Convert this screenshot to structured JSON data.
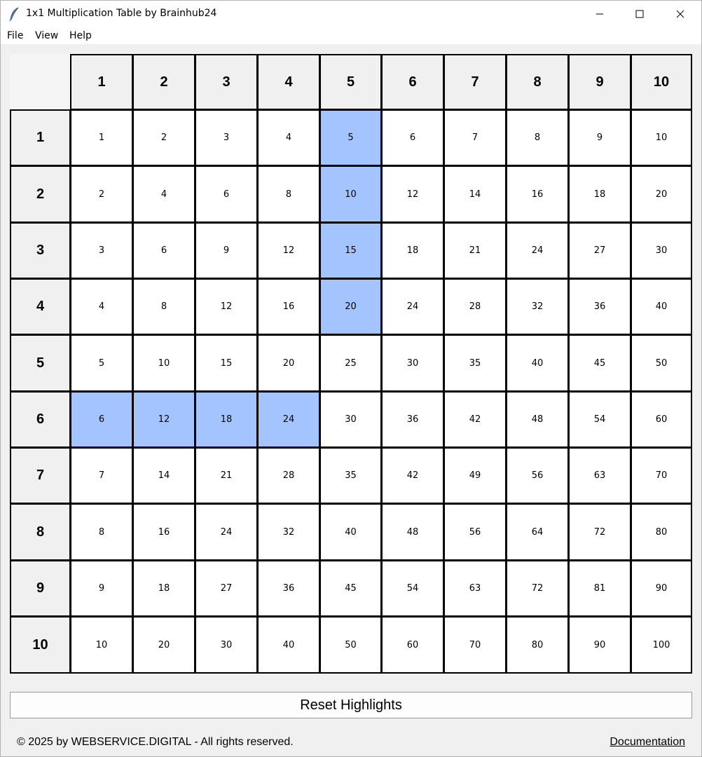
{
  "window": {
    "title": "1x1 Multiplication Table by Brainhub24",
    "icon": "feather-icon",
    "controls": [
      "minimize-icon",
      "maximize-icon",
      "close-icon"
    ]
  },
  "menu": [
    "File",
    "View",
    "Help"
  ],
  "table": {
    "column_headers": [
      "1",
      "2",
      "3",
      "4",
      "5",
      "6",
      "7",
      "8",
      "9",
      "10"
    ],
    "row_headers": [
      "1",
      "2",
      "3",
      "4",
      "5",
      "6",
      "7",
      "8",
      "9",
      "10"
    ],
    "rows": [
      [
        "1",
        "2",
        "3",
        "4",
        "5",
        "6",
        "7",
        "8",
        "9",
        "10"
      ],
      [
        "2",
        "4",
        "6",
        "8",
        "10",
        "12",
        "14",
        "16",
        "18",
        "20"
      ],
      [
        "3",
        "6",
        "9",
        "12",
        "15",
        "18",
        "21",
        "24",
        "27",
        "30"
      ],
      [
        "4",
        "8",
        "12",
        "16",
        "20",
        "24",
        "28",
        "32",
        "36",
        "40"
      ],
      [
        "5",
        "10",
        "15",
        "20",
        "25",
        "30",
        "35",
        "40",
        "45",
        "50"
      ],
      [
        "6",
        "12",
        "18",
        "24",
        "30",
        "36",
        "42",
        "48",
        "54",
        "60"
      ],
      [
        "7",
        "14",
        "21",
        "28",
        "35",
        "42",
        "49",
        "56",
        "63",
        "70"
      ],
      [
        "8",
        "16",
        "24",
        "32",
        "40",
        "48",
        "56",
        "64",
        "72",
        "80"
      ],
      [
        "9",
        "18",
        "27",
        "36",
        "45",
        "54",
        "63",
        "72",
        "81",
        "90"
      ],
      [
        "10",
        "20",
        "30",
        "40",
        "50",
        "60",
        "70",
        "80",
        "90",
        "100"
      ]
    ],
    "highlight_color": "#a3c4ff",
    "highlighted_cells": [
      [
        1,
        5
      ],
      [
        2,
        5
      ],
      [
        3,
        5
      ],
      [
        4,
        5
      ],
      [
        6,
        1
      ],
      [
        6,
        2
      ],
      [
        6,
        3
      ],
      [
        6,
        4
      ]
    ]
  },
  "reset_button_label": "Reset Highlights",
  "footer": {
    "copyright": "© 2025 by WEBSERVICE.DIGITAL - All rights reserved.",
    "documentation_link": "Documentation"
  }
}
